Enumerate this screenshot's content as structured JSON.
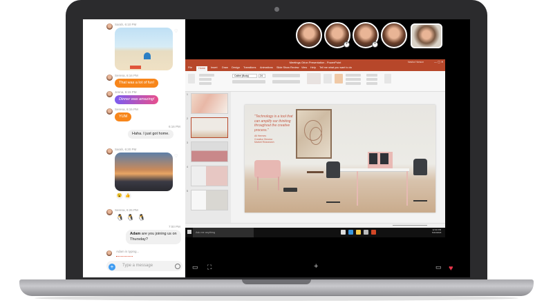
{
  "chat": {
    "messages": [
      {
        "sender_meta": "Sarah, 6:10 PM"
      },
      {
        "sender_meta": "Serena, 6:16 PM",
        "text": "That was a lot of fun!"
      },
      {
        "sender_meta": "Jenna, 6:15 PM",
        "text": "Dinner was amazing!"
      },
      {
        "sender_meta": "Serena, 6:15 PM",
        "text": "YUM"
      },
      {
        "sender_meta": "6:16 PM",
        "text": "Haha. I just got home."
      },
      {
        "sender_meta": "Sarah, 6:20 PM"
      },
      {
        "sender_meta": "Serena, 6:26 PM"
      },
      {
        "sender_meta": "7:00 PM",
        "text_bold": "Adam",
        "text": " are you joining us on Thursday?"
      }
    ],
    "typing_text": "Adam is typing...",
    "composer_placeholder": "Type a message",
    "sticker_glyphs": [
      "🐧",
      "🐧",
      "🐧"
    ],
    "reactions": [
      "😮",
      "👍"
    ]
  },
  "call": {
    "participants_count": 5,
    "badges": [
      "+",
      "+"
    ]
  },
  "powerpoint": {
    "window_title": "Meetings Orion Presentation - PowerPoint",
    "user_name": "Nasha Hanson",
    "tabs": [
      "File",
      "Home",
      "Insert",
      "Draw",
      "Design",
      "Transitions",
      "Animations",
      "Slide Show",
      "Review",
      "View",
      "Help",
      "Tell me what you want to do"
    ],
    "active_tab": "Home",
    "font_name": "Calibri (Body)",
    "font_size": "24",
    "slide_quote": "\"Technology is a tool that can amplify our thinking throughout the creative process.\"",
    "slide_credit": "Ali Hermes\nCreative Director\nMarket Reasearch",
    "thumb_numbers": [
      "1",
      "2",
      "3",
      "4",
      "5"
    ]
  },
  "taskbar": {
    "search_text": "Ask me anything",
    "time": "12:30 PM",
    "date": "5/22/2018"
  },
  "colors": {
    "accent_orange": "#f7861b",
    "ppt_red": "#b7472a",
    "heart_red": "#e8364b",
    "messenger_blue": "#3f9cf1"
  }
}
